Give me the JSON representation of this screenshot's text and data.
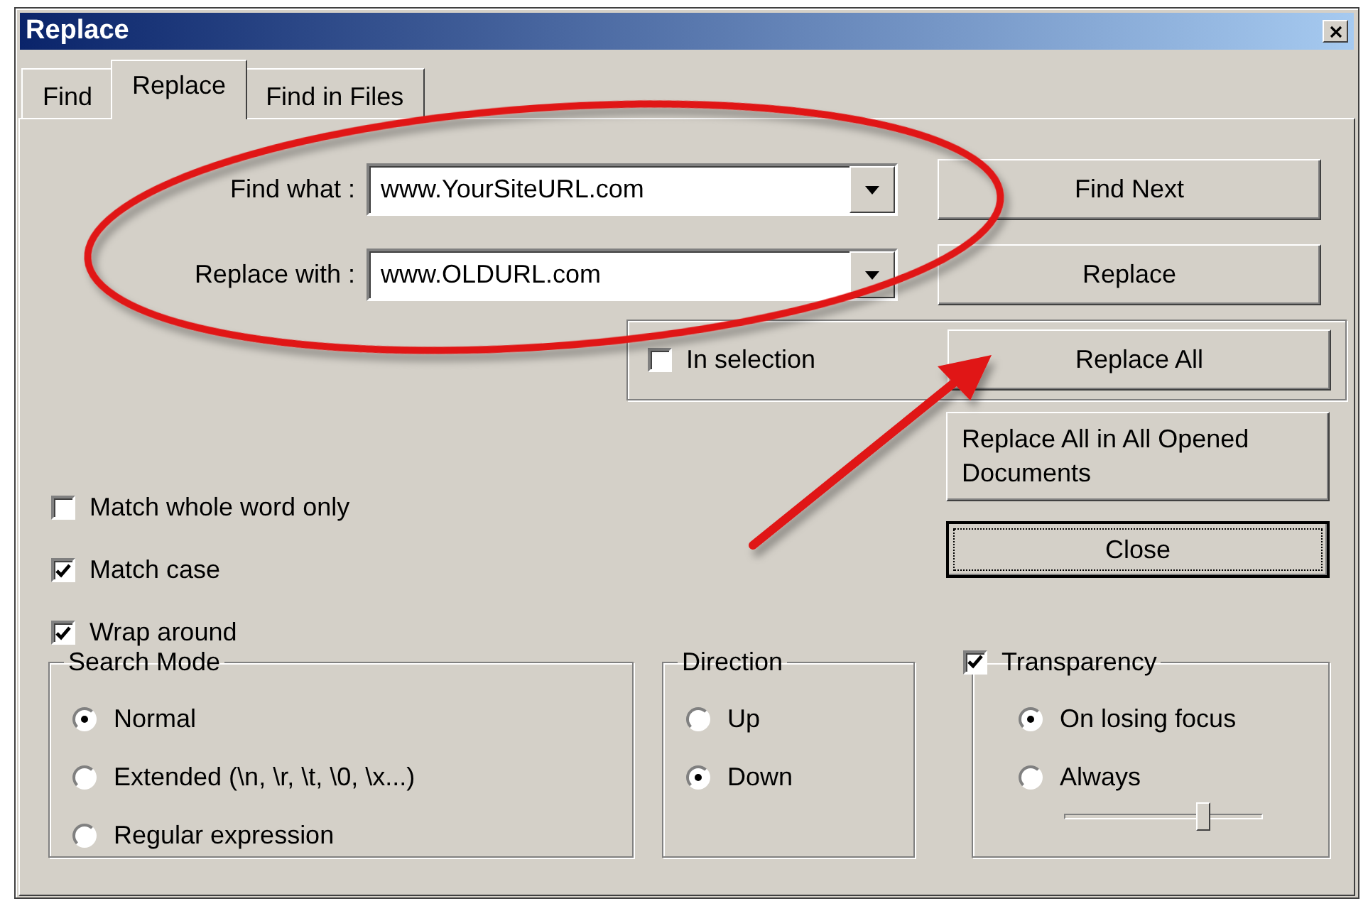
{
  "window": {
    "title": "Replace"
  },
  "tabs": [
    {
      "label": "Find",
      "selected": false
    },
    {
      "label": "Replace",
      "selected": true
    },
    {
      "label": "Find in Files",
      "selected": false
    }
  ],
  "fields": [
    {
      "label": "Find what :",
      "value": "www.YourSiteURL.com"
    },
    {
      "label": "Replace with :",
      "value": "www.OLDURL.com"
    }
  ],
  "in_selection": {
    "label": "In selection",
    "checked": false
  },
  "buttons": [
    {
      "label": "Find Next",
      "focused": false
    },
    {
      "label": "Replace",
      "focused": false
    },
    {
      "label": "Replace All",
      "focused": false
    },
    {
      "label": "Replace All in All Opened Documents",
      "focused": false
    },
    {
      "label": "Close",
      "focused": true
    }
  ],
  "options": [
    {
      "label": "Match whole word only",
      "checked": false
    },
    {
      "label": "Match case",
      "checked": true
    },
    {
      "label": "Wrap around",
      "checked": true
    }
  ],
  "search_mode": {
    "title": "Search Mode",
    "options": [
      {
        "label": "Normal",
        "selected": true
      },
      {
        "label": "Extended (\\n, \\r, \\t, \\0, \\x...)",
        "selected": false
      },
      {
        "label": "Regular expression",
        "selected": false
      }
    ]
  },
  "direction": {
    "title": "Direction",
    "options": [
      {
        "label": "Up",
        "selected": false
      },
      {
        "label": "Down",
        "selected": true
      }
    ]
  },
  "transparency": {
    "label": "Transparency",
    "checked": true,
    "options": [
      {
        "label": "On losing focus",
        "selected": true
      },
      {
        "label": "Always",
        "selected": false
      }
    ],
    "level": 0.7
  }
}
